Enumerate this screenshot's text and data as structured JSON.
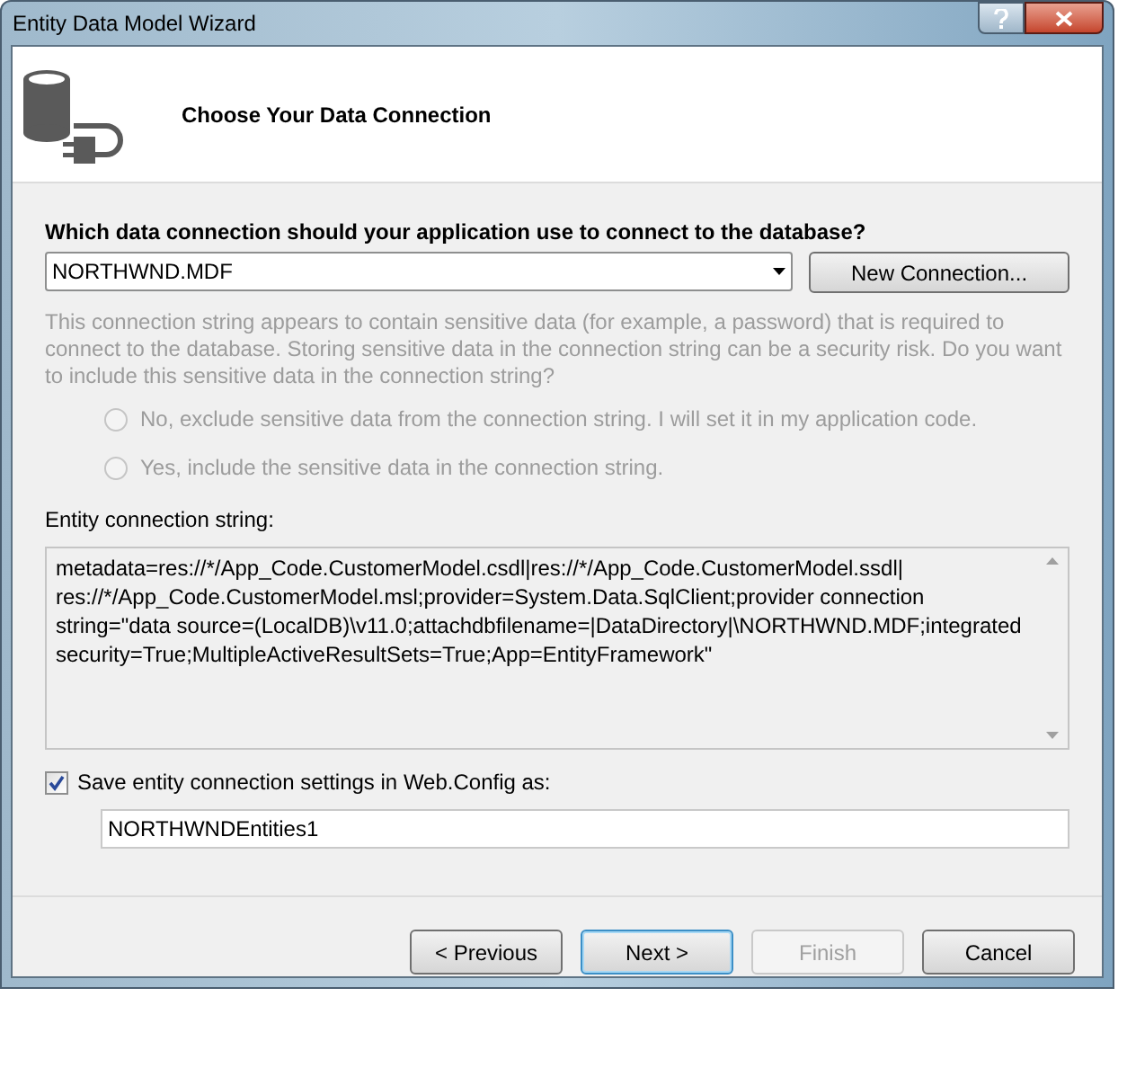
{
  "window": {
    "title": "Entity Data Model Wizard"
  },
  "header": {
    "title": "Choose Your Data Connection"
  },
  "question": "Which data connection should your application use to connect to the database?",
  "connection": {
    "value": "NORTHWND.MDF"
  },
  "new_connection_button": "New Connection...",
  "sensitive_notice": {
    "text": "This connection string appears to contain sensitive data (for example, a password) that is required to connect to the database. Storing sensitive data in the connection string can be a security risk. Do you want to include this sensitive data in the connection string?",
    "disabled": true
  },
  "sensitive_options": [
    {
      "label": "No, exclude sensitive data from the connection string. I will set it in my application code.",
      "selected": false,
      "disabled": true
    },
    {
      "label": "Yes, include the sensitive data in the connection string.",
      "selected": false,
      "disabled": true
    }
  ],
  "entity_connection": {
    "label": "Entity connection string:",
    "value": "metadata=res://*/App_Code.CustomerModel.csdl|res://*/App_Code.CustomerModel.ssdl|res://*/App_Code.CustomerModel.msl;provider=System.Data.SqlClient;provider connection string=\"data source=(LocalDB)\\v11.0;attachdbfilename=|DataDirectory|\\NORTHWND.MDF;integrated security=True;MultipleActiveResultSets=True;App=EntityFramework\""
  },
  "save_settings": {
    "label": "Save entity connection settings in Web.Config as:",
    "checked": true,
    "value": "NORTHWNDEntities1"
  },
  "buttons": [
    {
      "label": "< Previous",
      "disabled": false,
      "default": false
    },
    {
      "label": "Next >",
      "disabled": false,
      "default": true
    },
    {
      "label": "Finish",
      "disabled": true,
      "default": false
    },
    {
      "label": "Cancel",
      "disabled": false,
      "default": false
    }
  ]
}
